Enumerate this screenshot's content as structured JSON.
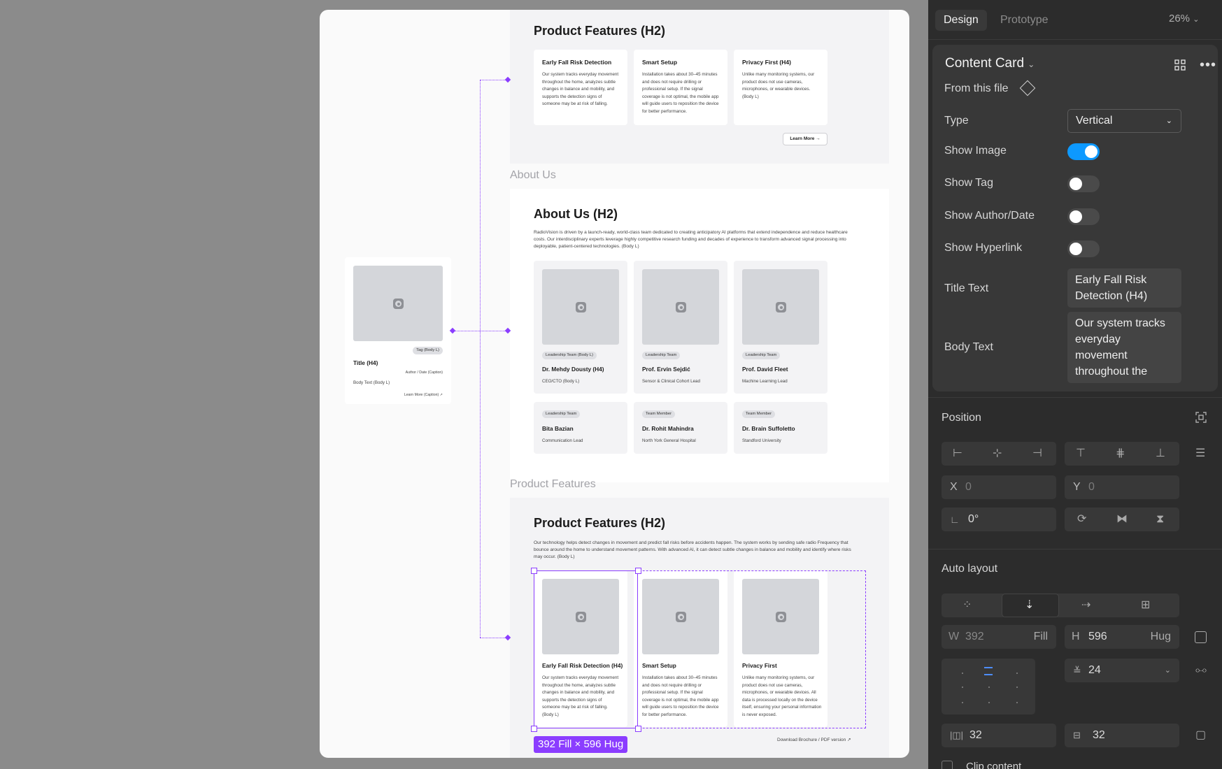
{
  "canvas": {
    "section_top": {
      "title": "Product Features (H2)",
      "cards": [
        {
          "title": "Early Fall Risk Detection",
          "body": [
            "Our system tracks everyday movement",
            "throughout the home, analyzes subtle",
            "changes in balance and mobility, and",
            "supports the detection signs of",
            "someone may be at risk of falling."
          ]
        },
        {
          "title": "Smart Setup",
          "body": [
            "Installation takes about 30–45 minutes",
            "and does not require drilling or",
            "professional setup. If the signal",
            "coverage is not optimal, the mobile app",
            "will guide users to reposition the device",
            "for better performance."
          ]
        },
        {
          "title": "Privacy First (H4)",
          "body": [
            "Unlike many monitoring systems, our",
            "product does not use cameras,",
            "microphones, or wearable devices.",
            "(Body L)"
          ]
        }
      ],
      "learn_more": "Learn More →"
    },
    "about_label": "About Us",
    "about": {
      "title": "About Us (H2)",
      "intro": [
        "RadioVision is driven by a launch-ready, world-class team dedicated to creating anticipatory AI platforms that extend independence and reduce healthcare",
        "costs. Our interdisciplinary experts leverage highly competitive research funding and decades of experience to transform advanced signal processing into",
        "deployable, patient-centered technologies. (Body L)"
      ],
      "people": [
        {
          "tag": "Leadership Team (Body L)",
          "name": "Dr. Mehdy Dousty (H4)",
          "role": "CEO/CTO (Body L)"
        },
        {
          "tag": "Leadership Team",
          "name": "Prof. Ervin Sejdić",
          "role": "Sensor & Clinical Cohort Lead"
        },
        {
          "tag": "Leadership Team",
          "name": "Prof. David Fleet",
          "role": "Machine Learning Lead"
        },
        {
          "tag": "Leadership Team",
          "name": "Bita Bazian",
          "role": "Communication Lead"
        },
        {
          "tag": "Team Member",
          "name": "Dr. Rohit Mahindra",
          "role": "North York General Hospital"
        },
        {
          "tag": "Team Member",
          "name": "Dr. Brain Suffoletto",
          "role": "Standford University"
        }
      ]
    },
    "features_label": "Product Features",
    "features": {
      "title": "Product Features (H2)",
      "intro": [
        "Our technology helps detect changes in movement and predict fall risks before accidents happen. The system works by sending safe radio Frequency that",
        "bounce around the home to understand movement patterns. With advanced AI, it can detect subtle changes in balance and mobility and identify where risks",
        "may occur. (Body L)"
      ],
      "cards": [
        {
          "title": "Early Fall Risk Detection (H4)",
          "body": [
            "Our system tracks everyday movement",
            "throughout the home, analyzes subtle",
            "changes in balance and mobility, and",
            "supports the detection signs of",
            "someone may be at risk of falling.",
            "(Body L)"
          ]
        },
        {
          "title": "Smart Setup",
          "body": [
            "Installation takes about 30–45 minutes",
            "and does not require drilling or",
            "professional setup. If the signal",
            "coverage is not optimal, the mobile app",
            "will guide users to reposition the device",
            "for better performance."
          ]
        },
        {
          "title": "Privacy First",
          "body": [
            "Unlike many monitoring systems, our",
            "product does not use cameras,",
            "microphones, or wearable devices. All",
            "data is processed locally on the device",
            "itself, ensuring your personal information",
            "is never exposed."
          ]
        }
      ],
      "download": "Download Brochure / PDF version ↗"
    },
    "component": {
      "tag": "Tag (Body L)",
      "title": "Title (H4)",
      "author": "Author / Date (Caption)",
      "body": "Body Text (Body L)",
      "learn": "Learn More (Caption) ↗"
    },
    "selection_badge": "392 Fill × 596 Hug"
  },
  "panel": {
    "tabs": [
      "Design",
      "Prototype"
    ],
    "zoom": "26%",
    "component_name": "Content Card",
    "source": "From this file",
    "type_label": "Type",
    "type_value": "Vertical",
    "toggles": [
      {
        "label": "Show Image",
        "on": true
      },
      {
        "label": "Show Tag",
        "on": false
      },
      {
        "label": "Show Author/Date",
        "on": false
      },
      {
        "label": "Show Hyperlink",
        "on": false
      }
    ],
    "title_text_label": "Title Text",
    "title_text_value": "Early Fall Risk Detection (H4)",
    "body_text_label": "Body Text",
    "body_text_value": "Our system tracks everyday movement throughout the",
    "position": {
      "title": "Position",
      "x_label": "X",
      "x_value": "0",
      "y_label": "Y",
      "y_value": "0",
      "rotation": "0°"
    },
    "auto_layout": {
      "title": "Auto layout",
      "w_label": "W",
      "w_value": "392",
      "w_mode": "Fill",
      "h_label": "H",
      "h_value": "596",
      "h_mode": "Hug",
      "gap": "24",
      "pad_h": "32",
      "pad_v": "32"
    },
    "clip_content": "Clip content"
  },
  "colors": {
    "accent": "#8b3dff",
    "toggle_on": "#0d99ff",
    "panel_bg": "#2c2c2c"
  }
}
